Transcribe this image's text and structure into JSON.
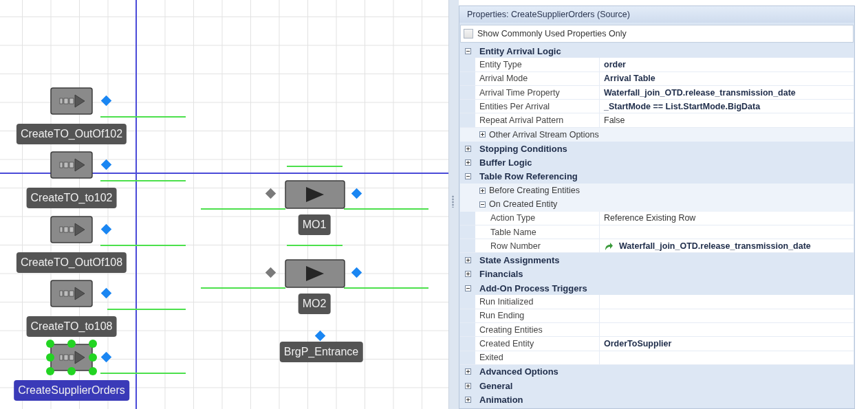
{
  "canvas": {
    "objects": [
      {
        "kind": "source",
        "label": "CreateTO_OutOf102",
        "selected": false
      },
      {
        "kind": "source",
        "label": "CreateTO_to102",
        "selected": false
      },
      {
        "kind": "source",
        "label": "CreateTO_OutOf108",
        "selected": false
      },
      {
        "kind": "source",
        "label": "CreateTO_to108",
        "selected": false
      },
      {
        "kind": "source",
        "label": "CreateSupplierOrders",
        "selected": true
      },
      {
        "kind": "server",
        "label": "MO1",
        "selected": false
      },
      {
        "kind": "server",
        "label": "MO2",
        "selected": false
      },
      {
        "kind": "node",
        "label": "BrgP_Entrance",
        "selected": false
      }
    ]
  },
  "properties": {
    "title": "Properties: CreateSupplierOrders (Source)",
    "common_only": {
      "label": "Show Commonly Used Properties Only",
      "checked": false
    },
    "categories": [
      {
        "label": "Entity Arrival Logic",
        "expanded": true,
        "children": [
          {
            "kind": "property",
            "name": "Entity Type",
            "value": "order",
            "modified": true
          },
          {
            "kind": "property",
            "name": "Arrival Mode",
            "value": "Arrival Table",
            "modified": true
          },
          {
            "kind": "property",
            "name": "Arrival Time Property",
            "value": "Waterfall_join_OTD.release_transmission_date",
            "modified": true
          },
          {
            "kind": "property",
            "name": "Entities Per Arrival",
            "value": "_StartMode == List.StartMode.BigData",
            "modified": true
          },
          {
            "kind": "property",
            "name": "Repeat Arrival Pattern",
            "value": "False",
            "modified": false
          },
          {
            "kind": "group",
            "label": "Other Arrival Stream Options",
            "expanded": false
          }
        ]
      },
      {
        "label": "Stopping Conditions",
        "expanded": false
      },
      {
        "label": "Buffer Logic",
        "expanded": false
      },
      {
        "label": "Table Row Referencing",
        "expanded": true,
        "children": [
          {
            "kind": "group",
            "label": "Before Creating Entities",
            "expanded": false
          },
          {
            "kind": "group",
            "label": "On Created Entity",
            "expanded": true,
            "children": [
              {
                "kind": "property",
                "name": "Action Type",
                "value": "Reference Existing Row",
                "modified": false
              },
              {
                "kind": "property",
                "name": "Table Name"
              },
              {
                "kind": "property",
                "name": "Row Number",
                "value": "Waterfall_join_OTD.release_transmission_date",
                "modified": true,
                "referenced": true
              }
            ]
          }
        ]
      },
      {
        "label": "State Assignments",
        "expanded": false
      },
      {
        "label": "Financials",
        "expanded": false
      },
      {
        "label": "Add-On Process Triggers",
        "expanded": true,
        "children": [
          {
            "kind": "property",
            "name": "Run Initialized"
          },
          {
            "kind": "property",
            "name": "Run Ending"
          },
          {
            "kind": "property",
            "name": "Creating Entities"
          },
          {
            "kind": "property",
            "name": "Created Entity",
            "value": "OrderToSupplier",
            "modified": true
          },
          {
            "kind": "property",
            "name": "Exited"
          }
        ]
      },
      {
        "label": "Advanced Options",
        "expanded": false
      },
      {
        "label": "General",
        "expanded": false
      },
      {
        "label": "Animation",
        "expanded": false
      }
    ]
  }
}
